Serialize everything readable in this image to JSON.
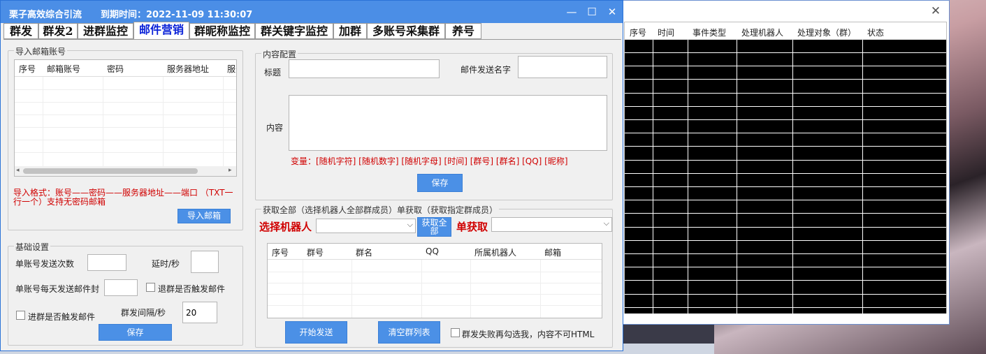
{
  "app": {
    "title": "栗子高效综合引流",
    "expiry": "到期时间：2022-11-09 11:30:07"
  },
  "window_controls": {
    "minimize": "—",
    "maximize": "☐",
    "close": "✕"
  },
  "tabs": [
    {
      "label": "群发",
      "active": false
    },
    {
      "label": "群发2",
      "active": false
    },
    {
      "label": "进群监控",
      "active": false
    },
    {
      "label": "邮件营销",
      "active": true
    },
    {
      "label": "群昵称监控",
      "active": false
    },
    {
      "label": "群关键字监控",
      "active": false
    },
    {
      "label": "加群",
      "active": false
    },
    {
      "label": "多账号采集群",
      "active": false
    },
    {
      "label": "养号",
      "active": false
    }
  ],
  "import_email": {
    "group_label": "导入邮箱账号",
    "columns": [
      "序号",
      "邮箱账号",
      "密码",
      "服务器地址",
      "服务"
    ],
    "hint": "导入格式：账号——密码——服务器地址——端口 （TXT一行一个）支持无密码邮箱",
    "button": "导入邮箱"
  },
  "basic": {
    "group_label": "基础设置",
    "send_count_label": "单账号发送次数",
    "delay_label": "延时/秒",
    "daily_label": "单账号每天发送邮件封",
    "exit_trigger_label": "退群是否触发邮件",
    "join_trigger_label": "进群是否触发邮件",
    "interval_label": "群发间隔/秒",
    "interval_value": "20",
    "save_button": "保存"
  },
  "content": {
    "group_label": "内容配置",
    "title_label": "标题",
    "sender_label": "邮件发送名字",
    "content_label": "内容",
    "variables": "变量：[随机字符] [随机数字] [随机字母] [时间] [群号] [群名] [QQ] [昵称]",
    "save_button": "保存"
  },
  "fetch": {
    "group_label": "获取全部（选择机器人全部群成员）单获取（获取指定群成员）",
    "robot_label": "选择机器人",
    "fetch_all_button": "获取全部",
    "single_label": "单获取",
    "columns": [
      "序号",
      "群号",
      "群名",
      "QQ",
      "所属机器人",
      "邮箱"
    ],
    "start_button": "开始发送",
    "clear_button": "清空群列表",
    "retry_label": "群发失败再勾选我，内容不可HTML"
  },
  "log": {
    "columns": [
      "序号",
      "时间",
      "事件类型",
      "处理机器人",
      "处理对象（群）",
      "状态"
    ],
    "close": "✕"
  }
}
